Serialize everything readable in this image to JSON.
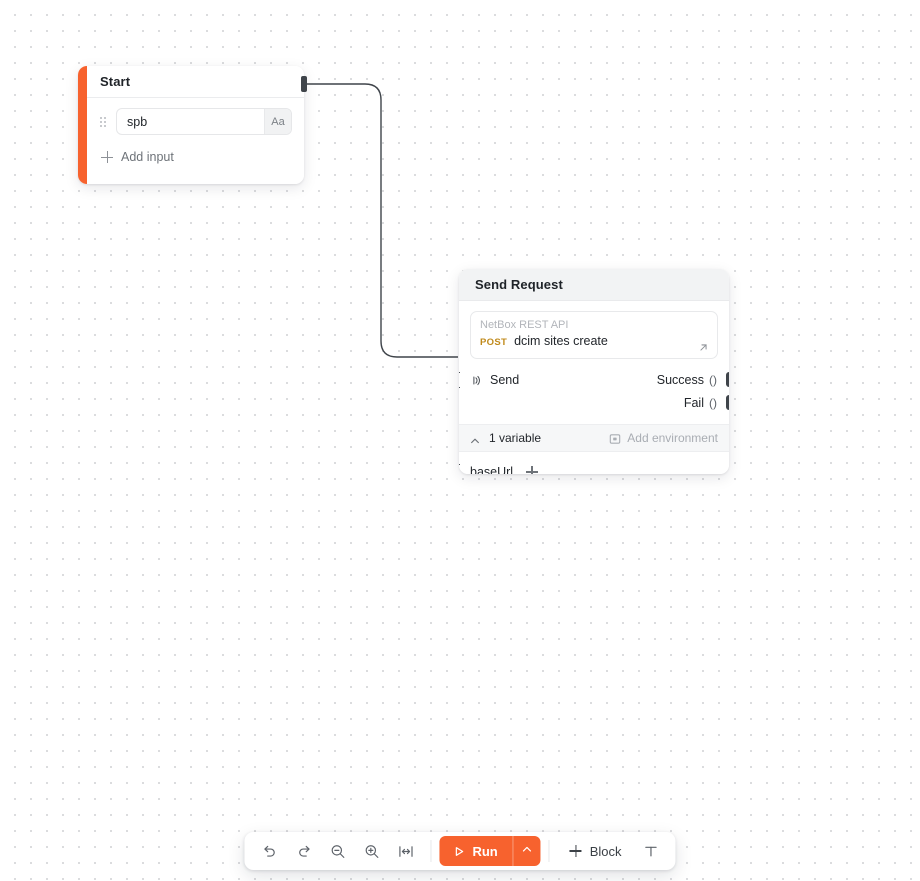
{
  "canvas": {
    "background_color": "#ffffff",
    "dot_color": "#d2d3d6"
  },
  "nodes": {
    "start": {
      "title": "Start",
      "accent_color": "#f7622e",
      "inputs": [
        {
          "value": "spb",
          "type_badge": "Aa"
        }
      ],
      "add_input_label": "Add input"
    },
    "send_request": {
      "title": "Send Request",
      "request": {
        "api_name": "NetBox REST API",
        "method": "POST",
        "method_color": "#c08a1b",
        "path": "dcim sites create"
      },
      "send_label": "Send",
      "outputs": [
        {
          "label": "Success",
          "value": "()"
        },
        {
          "label": "Fail",
          "value": "()"
        }
      ],
      "variables_summary": "1 variable",
      "add_environment_label": "Add environment",
      "variables": [
        {
          "name": "baseUrl"
        }
      ]
    }
  },
  "toolbar": {
    "undo_label": "Undo",
    "redo_label": "Redo",
    "zoom_out_label": "Zoom out",
    "zoom_in_label": "Zoom in",
    "fit_label": "Fit to screen",
    "run_label": "Run",
    "run_color": "#f7622e",
    "block_label": "Block",
    "text_tool_label": "Text"
  }
}
